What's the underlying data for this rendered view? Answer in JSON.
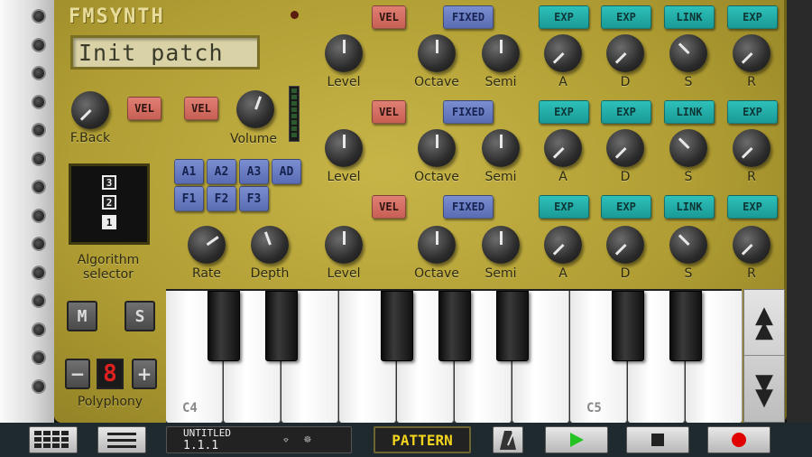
{
  "app": {
    "title": "FMSYNTH"
  },
  "patch": {
    "name": "Init patch"
  },
  "labels": {
    "feedback": "F.Back",
    "volume": "Volume",
    "level": "Level",
    "octave": "Octave",
    "semi": "Semi",
    "a": "A",
    "d": "D",
    "s": "S",
    "r": "R",
    "rate": "Rate",
    "depth": "Depth",
    "algorithm_selector": "Algorithm selector",
    "polyphony": "Polyphony"
  },
  "buttons": {
    "vel": "VEL",
    "fixed": "FIXED",
    "exp": "EXP",
    "link": "LINK",
    "mono": "M",
    "solo": "S",
    "minus": "−",
    "plus": "+",
    "pattern": "PATTERN"
  },
  "algorithm_buttons": [
    "A1",
    "A2",
    "A3",
    "AD",
    "F1",
    "F2",
    "F3"
  ],
  "algorithm_display": [
    "3",
    "2",
    "1"
  ],
  "polyphony": {
    "value": "8"
  },
  "keyboard": {
    "labels": [
      "C4",
      "C5"
    ]
  },
  "song": {
    "name": "UNTITLED",
    "position": "1.1.1"
  },
  "icons": {
    "grid": "grid-icon",
    "menu": "menu-icon",
    "metronome": "metronome-icon",
    "play": "play-icon",
    "stop": "stop-icon",
    "record": "record-icon",
    "wifi": "wifi-icon",
    "midi": "midi-icon",
    "octave_up": "octave-up-icon",
    "octave_down": "octave-down-icon"
  },
  "colors": {
    "panel": "#b09d33",
    "vel": "#d46c61",
    "fixed": "#6a7cc2",
    "exp": "#24aea9",
    "pattern": "#f3d51e",
    "play": "#22c322",
    "record": "#e00000"
  }
}
